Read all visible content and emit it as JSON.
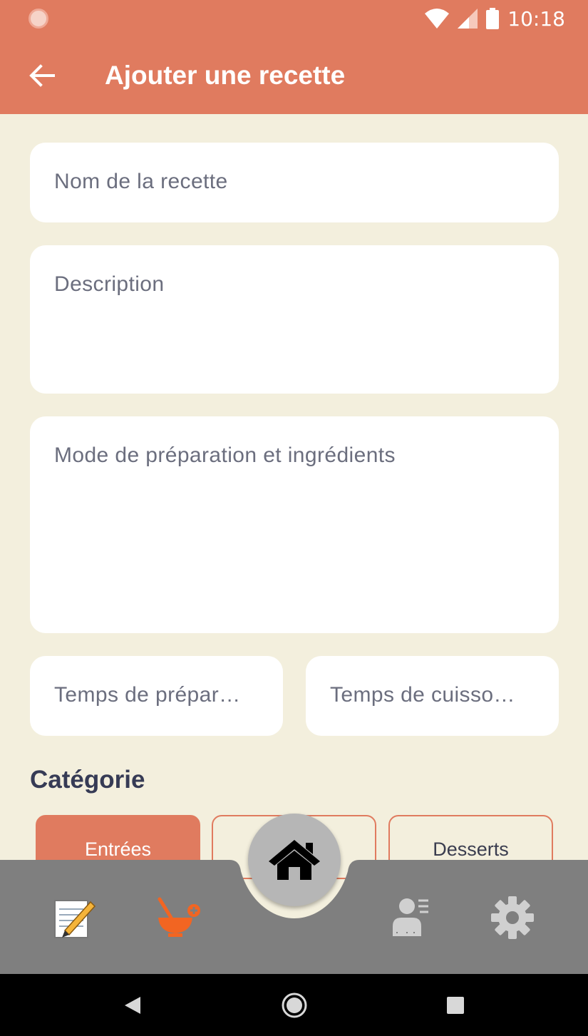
{
  "status_bar": {
    "time": "10:18",
    "icons": [
      "notification-dot-icon",
      "wifi-icon",
      "signal-icon",
      "battery-icon"
    ]
  },
  "app_bar": {
    "title": "Ajouter une recette",
    "back_icon": "arrow-back-icon"
  },
  "form": {
    "name_placeholder": "Nom de la recette",
    "description_placeholder": "Description",
    "mode_placeholder": "Mode de préparation et ingrédients",
    "prep_time_placeholder": "Temps de prépar…",
    "cook_time_placeholder": "Temps de cuisso…"
  },
  "category": {
    "title": "Catégorie",
    "chips": [
      {
        "label": "Entrées",
        "active": true
      },
      {
        "label": "",
        "active": false
      },
      {
        "label": "Desserts",
        "active": false
      }
    ]
  },
  "bottom_nav": {
    "items": [
      "notepad-icon",
      "bowl-add-icon",
      "home-icon",
      "profile-list-icon",
      "gear-icon"
    ],
    "active": "bowl-add-icon"
  },
  "system_nav": [
    "back-triangle-icon",
    "home-circle-icon",
    "recent-square-icon"
  ],
  "colors": {
    "primary": "#E07B5F",
    "background": "#F3EFDD",
    "nav_bar": "#7F7F7F",
    "active_icon": "#F26522"
  }
}
